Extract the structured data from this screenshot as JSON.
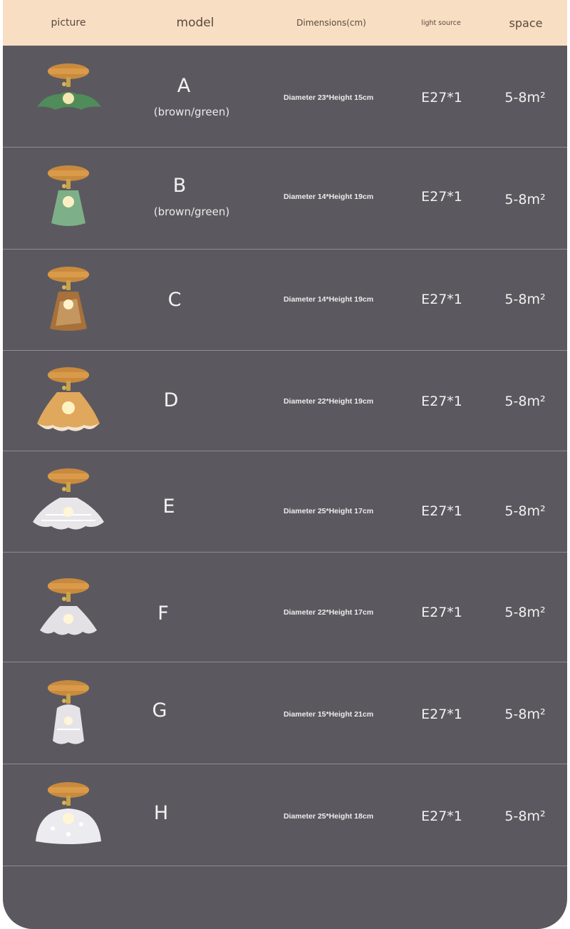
{
  "header": {
    "picture": "picture",
    "model": "model",
    "dimensions": "Dimensions(cm)",
    "light_source": "light source",
    "space": "space"
  },
  "rows": [
    {
      "model": "A",
      "variant": "(brown/green)",
      "dimensions": "Diameter 23*Height 15cm",
      "light_source": "E27*1",
      "space": "5-8m²",
      "shade": "green-leaf"
    },
    {
      "model": "B",
      "variant": "(brown/green)",
      "dimensions": "Diameter 14*Height 19cm",
      "light_source": "E27*1",
      "space": "5-8m²",
      "shade": "green-cup"
    },
    {
      "model": "C",
      "variant": "",
      "dimensions": "Diameter 14*Height 19cm",
      "light_source": "E27*1",
      "space": "5-8m²",
      "shade": "amber-cup"
    },
    {
      "model": "D",
      "variant": "",
      "dimensions": "Diameter 22*Height 19cm",
      "light_source": "E27*1",
      "space": "5-8m²",
      "shade": "amber-ruffle"
    },
    {
      "model": "E",
      "variant": "",
      "dimensions": "Diameter 25*Height 17cm",
      "light_source": "E27*1",
      "space": "5-8m²",
      "shade": "clear-wide"
    },
    {
      "model": "F",
      "variant": "",
      "dimensions": "Diameter 22*Height 17cm",
      "light_source": "E27*1",
      "space": "5-8m²",
      "shade": "clear-ruffle"
    },
    {
      "model": "G",
      "variant": "",
      "dimensions": "Diameter 15*Height 21cm",
      "light_source": "E27*1",
      "space": "5-8m²",
      "shade": "clear-tulip"
    },
    {
      "model": "H",
      "variant": "",
      "dimensions": "Diameter 25*Height 18cm",
      "light_source": "E27*1",
      "space": "5-8m²",
      "shade": "frosted-dome"
    }
  ],
  "colors": {
    "header_bg": "#f8dec3",
    "panel_bg": "#5b595f",
    "divider": "#8e8b92",
    "wood": "#c98a3e",
    "brass": "#c9a24a"
  }
}
